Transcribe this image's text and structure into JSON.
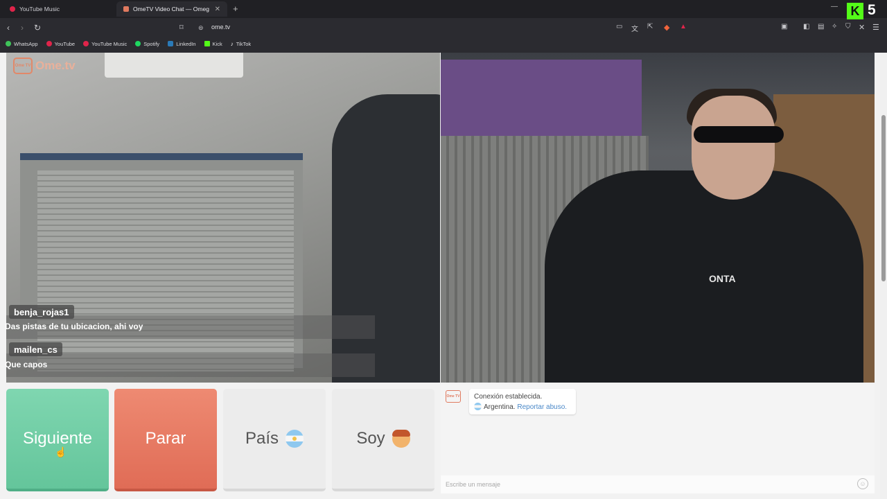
{
  "browser": {
    "tabs": [
      {
        "label": "YouTube Music",
        "icon": "youtube-music-icon",
        "color": "#e0244a"
      },
      {
        "label": "OmeTV Video Chat — Omeg",
        "icon": "ometv-tab-icon",
        "color": "#e07a5f"
      }
    ],
    "new_tab": "+",
    "url": "ome.tv",
    "kick_badge_letter": "K",
    "kick_badge_number": "5",
    "bookmarks": [
      {
        "label": "WhatsApp",
        "color": "#3fc45a"
      },
      {
        "label": "YouTube",
        "color": "#e0244a"
      },
      {
        "label": "YouTube Music",
        "color": "#e0244a"
      },
      {
        "label": "Spotify",
        "color": "#1ed760"
      },
      {
        "label": "LinkedIn",
        "color": "#2a7ab8"
      },
      {
        "label": "Kick",
        "color": "#53fc18"
      },
      {
        "label": "TikTok",
        "color": "#ffffff"
      }
    ]
  },
  "video": {
    "logo_text": "Ome.tv",
    "logo_badge": "Ome TV",
    "hoodie_text": "ONTA",
    "chat": [
      {
        "name": "benja_rojas1",
        "message": "Das pistas de tu ubicacion, ahi voy"
      },
      {
        "name": "mailen_cs",
        "message": "Que capos"
      }
    ]
  },
  "controls": {
    "next_label": "Siguiente",
    "stop_label": "Parar",
    "country_label": "País",
    "soy_label": "Soy",
    "next_color": "#6fcda4",
    "stop_color": "#e6765f"
  },
  "chat_panel": {
    "system_status": "Conexión establecida.",
    "country": "Argentina.",
    "report_link": "Reportar abuso.",
    "input_placeholder": "Escribe un mensaje"
  }
}
